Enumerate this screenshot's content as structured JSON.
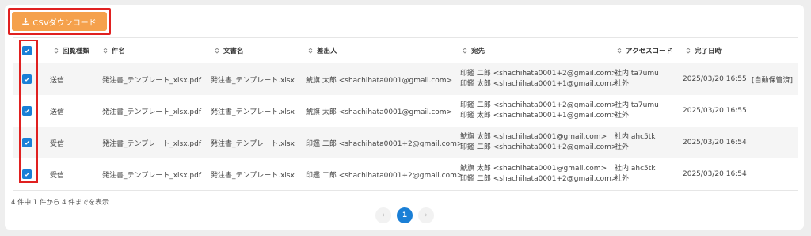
{
  "toolbar": {
    "csv_label": "CSVダウンロード",
    "download_icon": "download-icon"
  },
  "columns": [
    "回覧種類",
    "件名",
    "文書名",
    "差出人",
    "宛先",
    "アクセスコード",
    "完了日時"
  ],
  "rows": [
    {
      "type": "送信",
      "subject": "発注書_テンプレート_xlsx.pdf",
      "doc": "発注書_テンプレート.xlsx",
      "sender": "鯱旗 太郎 <shachihata0001@gmail.com>",
      "to1": "印鑑 二郎 <shachihata0001+2@gmail.com>",
      "to2": "印鑑 太郎 <shachihata0001+1@gmail.com>",
      "code1": "社内 ta7umu",
      "code2": "社外",
      "date": "2025/03/20 16:55",
      "note": "[自動保管済]",
      "checked": true
    },
    {
      "type": "送信",
      "subject": "発注書_テンプレート_xlsx.pdf",
      "doc": "発注書_テンプレート.xlsx",
      "sender": "鯱旗 太郎 <shachihata0001@gmail.com>",
      "to1": "印鑑 二郎 <shachihata0001+2@gmail.com>",
      "to2": "印鑑 太郎 <shachihata0001+1@gmail.com>",
      "code1": "社内 ta7umu",
      "code2": "社外",
      "date": "2025/03/20 16:55",
      "note": "",
      "checked": true
    },
    {
      "type": "受信",
      "subject": "発注書_テンプレート_xlsx.pdf",
      "doc": "発注書_テンプレート.xlsx",
      "sender": "印鑑 二郎 <shachihata0001+2@gmail.com>",
      "to1": "鯱旗 太郎 <shachihata0001@gmail.com>",
      "to2": "印鑑 二郎 <shachihata0001+2@gmail.com>",
      "code1": "社内 ahc5tk",
      "code2": "社外",
      "date": "2025/03/20 16:54",
      "note": "",
      "checked": true
    },
    {
      "type": "受信",
      "subject": "発注書_テンプレート_xlsx.pdf",
      "doc": "発注書_テンプレート.xlsx",
      "sender": "印鑑 二郎 <shachihata0001+2@gmail.com>",
      "to1": "鯱旗 太郎 <shachihata0001@gmail.com>",
      "to2": "印鑑 二郎 <shachihata0001+2@gmail.com>",
      "code1": "社内 ahc5tk",
      "code2": "社外",
      "date": "2025/03/20 16:54",
      "note": "",
      "checked": true
    }
  ],
  "footer": {
    "status": "4 件中 1 件から 4 件までを表示",
    "prev": "‹",
    "page": "1",
    "next": "›"
  },
  "colors": {
    "accent": "#1a7fd6",
    "csv_button": "#f5a14c",
    "highlight": "#e02020"
  }
}
